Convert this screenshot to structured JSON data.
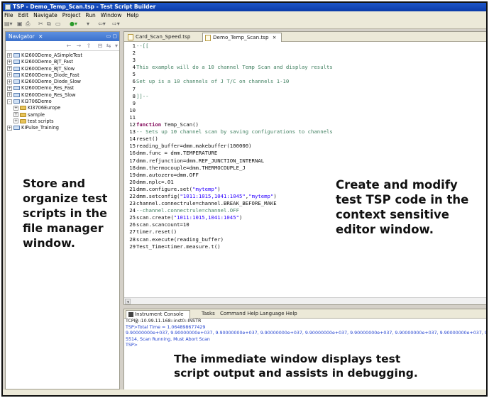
{
  "window": {
    "title": "TSP - Demo_Temp_Scan.tsp - Test Script Builder"
  },
  "menubar": {
    "items": [
      "File",
      "Edit",
      "Navigate",
      "Project",
      "Run",
      "Window",
      "Help"
    ]
  },
  "navigator": {
    "tab_label": "Navigator",
    "tree": [
      {
        "label": "KI2600Demo_ASimpleTest",
        "toggle": "+",
        "indent": 0,
        "type": "project"
      },
      {
        "label": "KI2600Demo_BJT_Fast",
        "toggle": "+",
        "indent": 0,
        "type": "project"
      },
      {
        "label": "KI2600Demo_BJT_Slow",
        "toggle": "+",
        "indent": 0,
        "type": "project"
      },
      {
        "label": "KI2600Demo_Diode_Fast",
        "toggle": "+",
        "indent": 0,
        "type": "project"
      },
      {
        "label": "KI2600Demo_Diode_Slow",
        "toggle": "+",
        "indent": 0,
        "type": "project"
      },
      {
        "label": "KI2600Demo_Res_Fast",
        "toggle": "+",
        "indent": 0,
        "type": "project"
      },
      {
        "label": "KI2600Demo_Res_Slow",
        "toggle": "+",
        "indent": 0,
        "type": "project"
      },
      {
        "label": "KI3706Demo",
        "toggle": "-",
        "indent": 0,
        "type": "project"
      },
      {
        "label": "KI3706Europe",
        "toggle": "+",
        "indent": 1,
        "type": "folder"
      },
      {
        "label": "sample",
        "toggle": "+",
        "indent": 1,
        "type": "folder"
      },
      {
        "label": "test scripts",
        "toggle": "+",
        "indent": 1,
        "type": "folder"
      },
      {
        "label": "KIPulse_Training",
        "toggle": "+",
        "indent": 0,
        "type": "project"
      }
    ]
  },
  "callouts": {
    "file_manager": [
      "Store and",
      "organize test",
      "scripts in the",
      "file manager",
      "window."
    ],
    "editor": [
      "Create and modify",
      "test TSP code in the",
      "context sensitive",
      "editor window."
    ],
    "immediate": [
      "The immediate window displays test",
      "script output and assists in debugging."
    ]
  },
  "editor": {
    "tabs": [
      {
        "label": "Card_Scan_Speed.tsp",
        "active": false
      },
      {
        "label": "Demo_Temp_Scan.tsp",
        "active": true
      }
    ],
    "lines": [
      {
        "num": "1",
        "text": "--[[",
        "style": "cmt"
      },
      {
        "num": "2",
        "text": "",
        "style": "plain"
      },
      {
        "num": "3",
        "text": "",
        "style": "plain"
      },
      {
        "num": "4",
        "text": "This example will do a 10 channel Temp Scan and display results",
        "style": "cmt"
      },
      {
        "num": "5",
        "text": "",
        "style": "plain"
      },
      {
        "num": "6",
        "text": "Set up is a 10 channels of J T/C on channels 1-10",
        "style": "cmt"
      },
      {
        "num": "7",
        "text": "",
        "style": "plain"
      },
      {
        "num": "8",
        "text": "]]--",
        "style": "cmt"
      },
      {
        "num": "9",
        "text": "",
        "style": "plain"
      },
      {
        "num": "10",
        "text": "",
        "style": "plain"
      },
      {
        "num": "11",
        "text": "",
        "style": "plain"
      },
      {
        "num": "12",
        "text": "function Temp_Scan()",
        "style": "func"
      },
      {
        "num": "13",
        "text": "-- Sets up 10 channel scan by saving configurations to channels",
        "style": "cmt"
      },
      {
        "num": "14",
        "text": "reset()",
        "style": "plain"
      },
      {
        "num": "15",
        "text": "reading_buffer=dmm.makebuffer(100000)",
        "style": "plain"
      },
      {
        "num": "16",
        "text": "dmm.func = dmm.TEMPERATURE",
        "style": "plain"
      },
      {
        "num": "17",
        "text": "dmm.refjunction=dmm.REF_JUNCTION_INTERNAL",
        "style": "plain"
      },
      {
        "num": "18",
        "text": "dmm.thermocouple=dmm.THERMOCOUPLE_J",
        "style": "plain"
      },
      {
        "num": "19",
        "text": "dmm.autozero=dmm.OFF",
        "style": "plain"
      },
      {
        "num": "20",
        "text": "dmm.nplc=.01",
        "style": "plain"
      },
      {
        "num": "21",
        "text": "dmm.configure.set(\"mytemp\")",
        "style": "str1"
      },
      {
        "num": "22",
        "text": "dmm.setconfig(\"1011:1015,1041:1045\",\"mytemp\")",
        "style": "str2"
      },
      {
        "num": "23",
        "text": "channel.connectrule=channel.BREAK_BEFORE_MAKE",
        "style": "plain"
      },
      {
        "num": "24",
        "text": "--channel.connectrule=channel.OFF",
        "style": "cmt"
      },
      {
        "num": "25",
        "text": "scan.create(\"1011:1015,1041:1045\")",
        "style": "str1"
      },
      {
        "num": "26",
        "text": "scan.scancount=10",
        "style": "plain"
      },
      {
        "num": "27",
        "text": "timer.reset()",
        "style": "plain"
      },
      {
        "num": "28",
        "text": "scan.execute(reading_buffer)",
        "style": "plain"
      },
      {
        "num": "29",
        "text": "Test_Time=timer.measure.t()",
        "style": "plain"
      }
    ]
  },
  "console": {
    "tabs": [
      {
        "label": "Instrument Console",
        "active": true
      },
      {
        "label": "Tasks",
        "active": false
      },
      {
        "label": "Command Help",
        "active": false
      },
      {
        "label": "Language Help",
        "active": false
      }
    ],
    "lines": [
      {
        "text": "TCPIP::10.99.11.168::inst0::INSTR",
        "color": "black"
      },
      {
        "text": "TSP>Total Time = 1.064898677429",
        "color": "blue"
      },
      {
        "text": "9.90000000e+037, 9.90000000e+037, 9.90000000e+037, 9.90000000e+037, 9.90000000e+037, 9.90000000e+037, 9.90000000e+037, 9.90000000e+037, 9.900000",
        "color": "blue"
      },
      {
        "text": "5514, Scan Running, Must Abort Scan",
        "color": "blue"
      },
      {
        "text": "TSP>",
        "color": "blue"
      }
    ]
  },
  "colors": {
    "comment": "#3f7f5f",
    "keyword": "#7f0055",
    "string": "#2a00ff",
    "console_output": "#1f3fcf",
    "titlebar": "#0a3aa8"
  }
}
